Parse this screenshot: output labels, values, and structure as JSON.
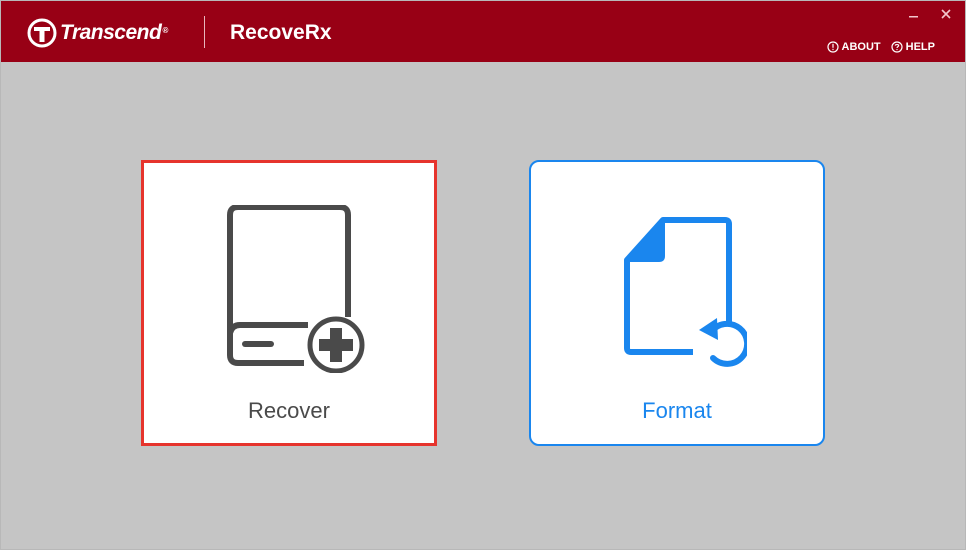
{
  "header": {
    "brand": "Transcend",
    "brand_mark": "®",
    "app_title": "RecoveRx",
    "about_label": "ABOUT",
    "help_label": "HELP",
    "about_icon": "info-circle-icon",
    "help_icon": "question-circle-icon"
  },
  "window_controls": {
    "minimize_icon": "minimize-icon",
    "close_icon": "close-icon"
  },
  "cards": {
    "recover": {
      "label": "Recover",
      "icon": "drive-plus-icon",
      "selected": true
    },
    "format": {
      "label": "Format",
      "icon": "document-restore-icon",
      "selected": false
    }
  },
  "colors": {
    "titlebar": "#980015",
    "background": "#c5c5c5",
    "selected_border": "#e6342d",
    "accent_blue": "#1a86ee",
    "icon_gray": "#4a4a4a"
  }
}
